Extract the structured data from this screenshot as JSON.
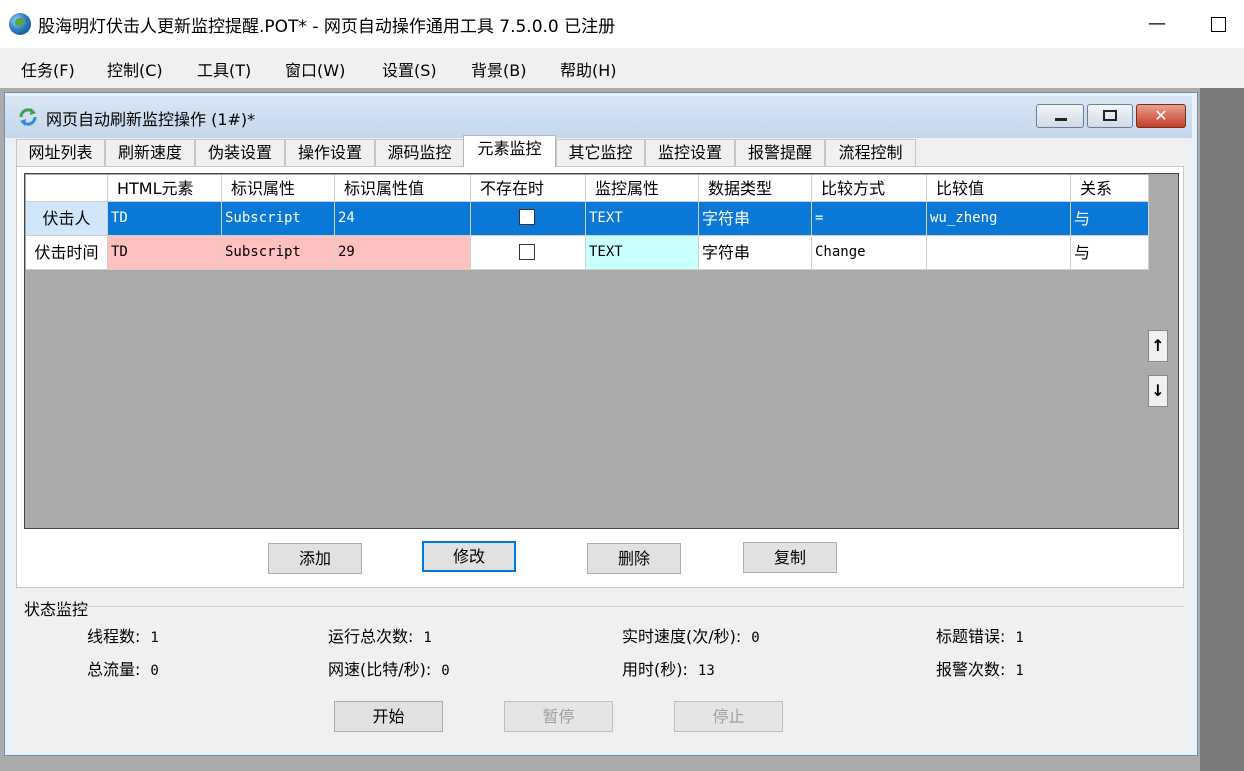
{
  "app": {
    "title": "股海明灯伏击人更新监控提醒.POT* - 网页自动操作通用工具 7.5.0.0  已注册",
    "minimize_glyph": "—"
  },
  "menu": [
    "任务(F)",
    "控制(C)",
    "工具(T)",
    "窗口(W)",
    "设置(S)",
    "背景(B)",
    "帮助(H)"
  ],
  "child_window": {
    "title": "网页自动刷新监控操作  (1#)*",
    "close_glyph": "✕"
  },
  "tabs": [
    "网址列表",
    "刷新速度",
    "伪装设置",
    "操作设置",
    "源码监控",
    "元素监控",
    "其它监控",
    "监控设置",
    "报警提醒",
    "流程控制"
  ],
  "active_tab": "元素监控",
  "grid": {
    "columns": [
      "HTML元素",
      "标识属性",
      "标识属性值",
      "不存在时",
      "监控属性",
      "数据类型",
      "比较方式",
      "比较值",
      "关系"
    ],
    "rows": [
      {
        "name": "伏击人",
        "html": "TD",
        "attr": "Subscript",
        "attr_value": "24",
        "not_exist": false,
        "monitor_attr": "TEXT",
        "data_type": "字符串",
        "compare": "=",
        "compare_value": "wu_zheng",
        "relation": "与"
      },
      {
        "name": "伏击时间",
        "html": "TD",
        "attr": "Subscript",
        "attr_value": "29",
        "not_exist": false,
        "monitor_attr": "TEXT",
        "data_type": "字符串",
        "compare": "Change",
        "compare_value": "",
        "relation": "与"
      }
    ],
    "move_up": "↑",
    "move_down": "↓"
  },
  "actions": {
    "add": "添加",
    "edit": "修改",
    "delete": "删除",
    "copy": "复制"
  },
  "status": {
    "group_title": "状态监控",
    "threads_label": "线程数:",
    "threads": "1",
    "total_runs_label": "运行总次数:",
    "total_runs": "1",
    "speed_label": "实时速度(次/秒):",
    "speed": "0",
    "title_errors_label": "标题错误:",
    "title_errors": "1",
    "traffic_label": "总流量:",
    "traffic": "0",
    "net_speed_label": "网速(比特/秒):",
    "net_speed": "0",
    "elapsed_label": "用时(秒):",
    "elapsed": "13",
    "alarms_label": "报警次数:",
    "alarms": "1"
  },
  "controls": {
    "start": "开始",
    "pause": "暂停",
    "stop": "停止"
  }
}
